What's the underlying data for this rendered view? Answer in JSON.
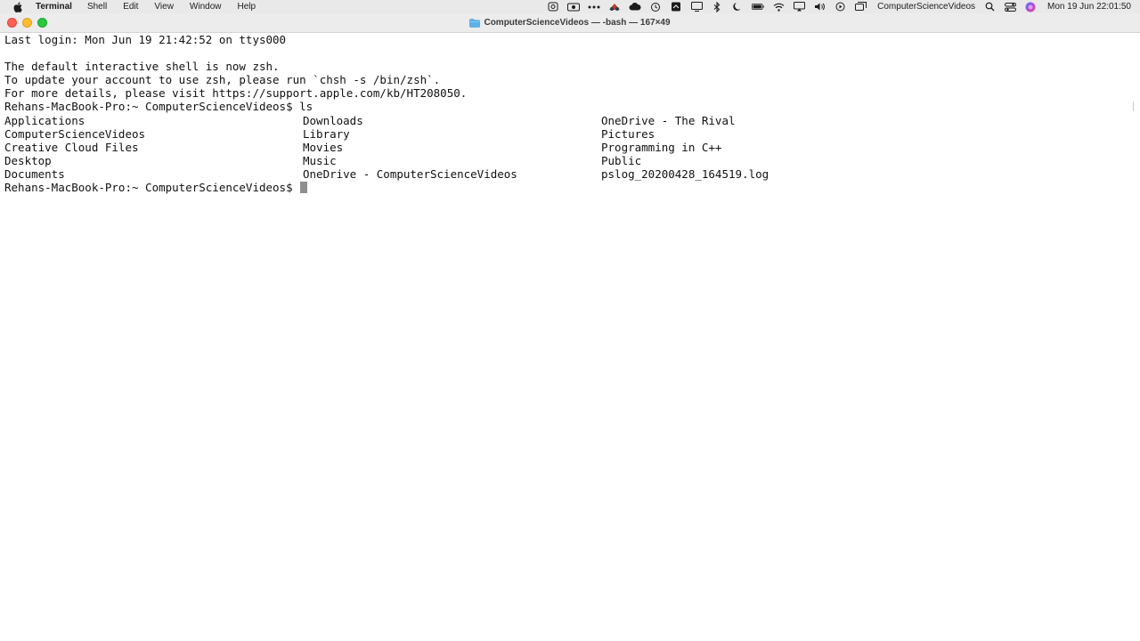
{
  "menubar": {
    "items": [
      "Terminal",
      "Shell",
      "Edit",
      "View",
      "Window",
      "Help"
    ],
    "status_account": "ComputerScienceVideos",
    "clock": "Mon 19 Jun  22:01:50",
    "status_icons": [
      "screen-capture-icon",
      "camera-icon",
      "more-icon",
      "flag-app-icon",
      "cloud-icon",
      "time-machine-icon",
      "document-icon",
      "display-icon",
      "bluetooth-icon",
      "moon-icon",
      "battery-icon",
      "wifi-icon",
      "airplay-icon",
      "volume-icon",
      "play-icon",
      "screens-icon",
      "spotlight-icon",
      "control-center-icon",
      "siri-icon"
    ]
  },
  "window": {
    "title": "ComputerScienceVideos — -bash — 167×49"
  },
  "terminal": {
    "last_login": "Last login: Mon Jun 19 21:42:52 on ttys000",
    "blank": "",
    "shell_notice_1": "The default interactive shell is now zsh.",
    "shell_notice_2": "To update your account to use zsh, please run `chsh -s /bin/zsh`.",
    "shell_notice_3": "For more details, please visit https://support.apple.com/kb/HT208050.",
    "command_line": "Rehans-MacBook-Pro:~ ComputerScienceVideos$ ls",
    "ls_rows": [
      [
        "Applications",
        "Downloads",
        "OneDrive - The Rival"
      ],
      [
        "ComputerScienceVideos",
        "Library",
        "Pictures"
      ],
      [
        "Creative Cloud Files",
        "Movies",
        "Programming in C++"
      ],
      [
        "Desktop",
        "Music",
        "Public"
      ],
      [
        "Documents",
        "OneDrive - ComputerScienceVideos",
        "pslog_20200428_164519.log"
      ]
    ],
    "prompt": "Rehans-MacBook-Pro:~ ComputerScienceVideos$ "
  },
  "colors": {
    "menubar_bg": "#e9e9ea",
    "titlebar_bg": "#ececec",
    "terminal_bg": "#ffffff",
    "terminal_text": "#111111",
    "cursor": "#8e8e8e",
    "close": "#fe5f57",
    "minimize": "#febc2e",
    "zoom": "#28c840"
  }
}
